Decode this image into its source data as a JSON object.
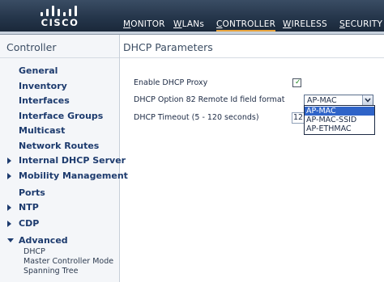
{
  "brand": {
    "logo_text": "CISCO"
  },
  "nav": {
    "items": [
      {
        "label": "MONITOR",
        "underline": "M",
        "rest": "ONITOR"
      },
      {
        "label": "WLANs",
        "underline": "W",
        "rest": "LANs"
      },
      {
        "label": "CONTROLLER",
        "underline": "C",
        "rest": "ONTROLLER"
      },
      {
        "label": "WIRELESS",
        "underline": "W",
        "rest": "IRELESS"
      },
      {
        "label": "SECURITY",
        "underline": "S",
        "rest": "ECURITY"
      }
    ],
    "active": "CONTROLLER"
  },
  "sidebar": {
    "title": "Controller",
    "items": [
      {
        "label": "General"
      },
      {
        "label": "Inventory"
      },
      {
        "label": "Interfaces"
      },
      {
        "label": "Interface Groups"
      },
      {
        "label": "Multicast"
      },
      {
        "label": "Network Routes"
      },
      {
        "label": "Internal DHCP Server",
        "expander": "collapsed"
      },
      {
        "label": "Mobility Management",
        "expander": "collapsed"
      },
      {
        "label": "Ports"
      },
      {
        "label": "NTP",
        "expander": "collapsed"
      },
      {
        "label": "CDP",
        "expander": "collapsed"
      },
      {
        "label": "Advanced",
        "expander": "expanded"
      }
    ],
    "sub_items": [
      {
        "label": "DHCP"
      },
      {
        "label": "Master Controller Mode"
      },
      {
        "label": "Spanning Tree"
      }
    ]
  },
  "main": {
    "title": "DHCP Parameters",
    "fields": {
      "proxy_label": "Enable DHCP Proxy",
      "proxy_checked": true,
      "option82_label": "DHCP Option 82 Remote Id field format",
      "option82_value": "AP-MAC",
      "option82_options": [
        "AP-MAC",
        "AP-MAC-SSID",
        "AP-ETHMAC"
      ],
      "timeout_label": "DHCP Timeout (5 - 120 seconds)",
      "timeout_value": "12"
    }
  },
  "colors": {
    "header": "#25364b",
    "active_underline": "#e8a33b",
    "link": "#1d3b6e",
    "selected_option": "#2f64c8"
  }
}
